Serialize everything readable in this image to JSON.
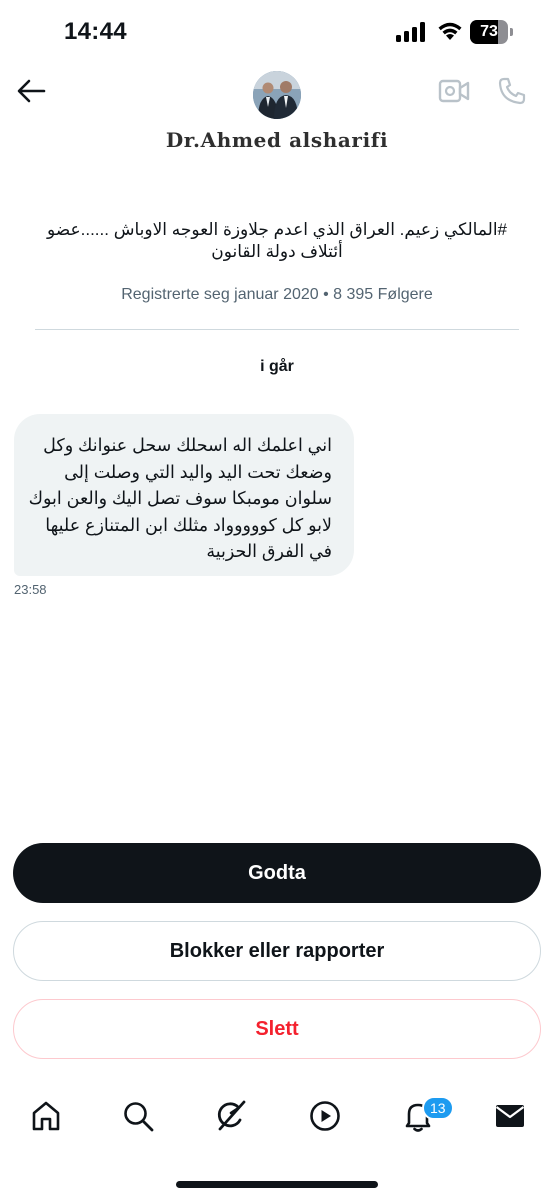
{
  "status_bar": {
    "time": "14:44",
    "battery_level": "73",
    "battery_fraction": 0.73
  },
  "header": {
    "display_name": "Dr.Ahmed alsharifi",
    "back_icon": "arrow-left-icon",
    "video_icon": "video-camera-icon",
    "call_icon": "phone-icon"
  },
  "profile": {
    "bio": "#المالكي زعيم. العراق الذي اعدم جلاوزة العوجه الاوباش ......عضو أئتلاف  دولة القانون",
    "meta": "Registrerte seg januar 2020 • 8 395 Følgere"
  },
  "conversation": {
    "date_separator": "i går",
    "messages": [
      {
        "text": "اني اعلمك اله اسحلك سحل عنوانك وكل وضعك تحت اليد واليد التي وصلت إلى سلوان مومبكا سوف تصل اليك والعن ابوك لابو كل كووووواد مثلك ابن المتنازع عليها في الفرق الحزبية",
        "time": "23:58"
      }
    ]
  },
  "actions": {
    "accept_label": "Godta",
    "block_label": "Blokker eller rapporter",
    "delete_label": "Slett"
  },
  "tab_bar": {
    "items": [
      "home-icon",
      "search-icon",
      "grok-icon",
      "video-play-icon",
      "notifications-bell-icon",
      "messages-envelope-icon"
    ],
    "notification_badge": "13"
  },
  "colors": {
    "accent": "#1d9bf0",
    "text": "#0f1419",
    "secondary_text": "#536471",
    "bubble": "#eff3f4",
    "danger": "#f4212e"
  }
}
